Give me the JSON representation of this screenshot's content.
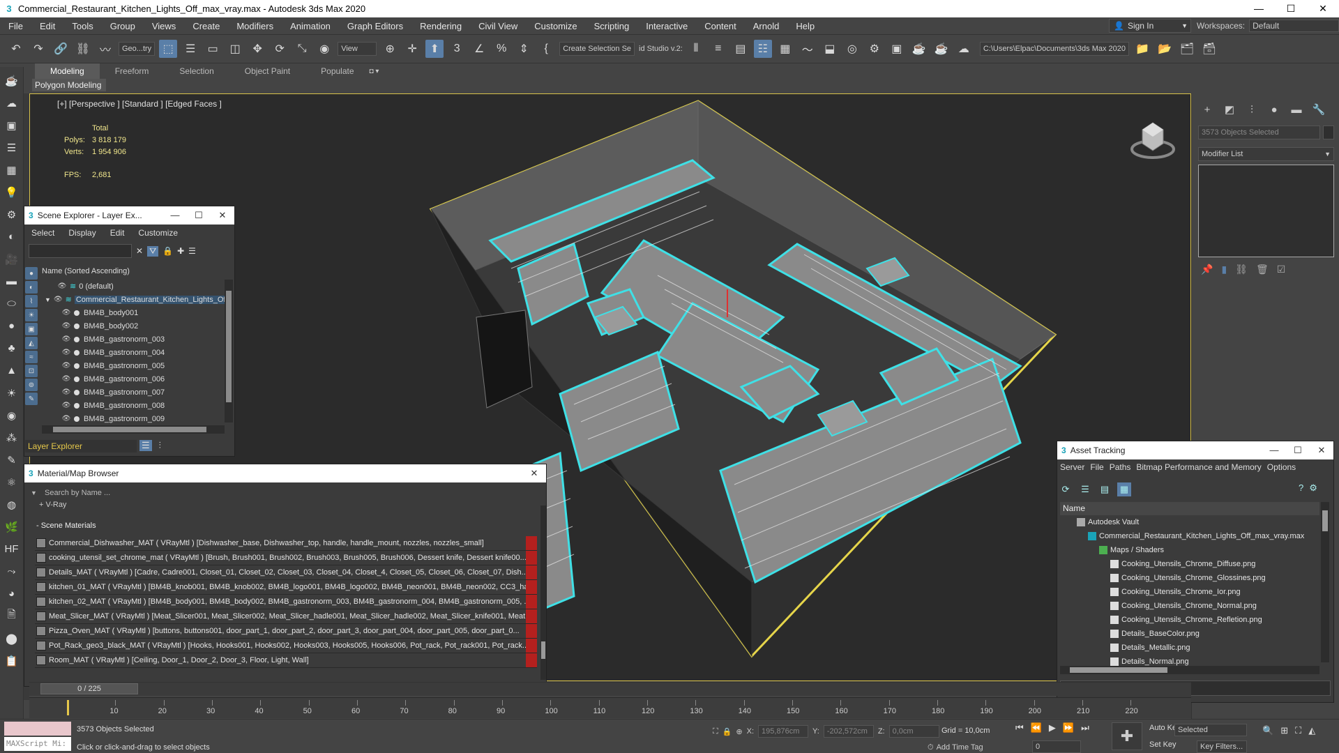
{
  "title": "Commercial_Restaurant_Kitchen_Lights_Off_max_vray.max - Autodesk 3ds Max 2020",
  "window_buttons": [
    "—",
    "☐",
    "✕"
  ],
  "menu": [
    "File",
    "Edit",
    "Tools",
    "Group",
    "Views",
    "Create",
    "Modifiers",
    "Animation",
    "Graph Editors",
    "Rendering",
    "Civil View",
    "Customize",
    "Scripting",
    "Interactive",
    "Content",
    "Arnold",
    "Help"
  ],
  "signin": "Sign In",
  "workspace": {
    "label": "Workspaces:",
    "value": "Default"
  },
  "toolbar": {
    "geometry_filter": "Geo...try",
    "view_drop": "View",
    "create_selection_set": "Create Selection Se",
    "studio_label": "id Studio v.2:",
    "path": "C:\\Users\\Elpac\\Documents\\3ds Max 2020"
  },
  "ribbon_tabs": [
    "Modeling",
    "Freeform",
    "Selection",
    "Object Paint",
    "Populate"
  ],
  "polygon_modeling": "Polygon Modeling",
  "viewport": {
    "label": "[+] [Perspective ] [Standard ] [Edged Faces ]",
    "stats_total": "Total",
    "polys_label": "Polys:",
    "polys": "3 818 179",
    "verts_label": "Verts:",
    "verts": "1 954 906",
    "fps_label": "FPS:",
    "fps": "2,681"
  },
  "command_panel": {
    "objects_selected": "3573 Objects Selected",
    "modifier_list": "Modifier List"
  },
  "scene_explorer": {
    "title": "Scene Explorer - Layer Ex...",
    "menu": [
      "Select",
      "Display",
      "Edit",
      "Customize"
    ],
    "column": "Name (Sorted Ascending)",
    "rows": [
      {
        "name": "0 (default)",
        "selected": false
      },
      {
        "name": "Commercial_Restaurant_Kitchen_Lights_Off",
        "selected": true
      },
      {
        "name": "BM4B_body001",
        "selected": false
      },
      {
        "name": "BM4B_body002",
        "selected": false
      },
      {
        "name": "BM4B_gastronorm_003",
        "selected": false
      },
      {
        "name": "BM4B_gastronorm_004",
        "selected": false
      },
      {
        "name": "BM4B_gastronorm_005",
        "selected": false
      },
      {
        "name": "BM4B_gastronorm_006",
        "selected": false
      },
      {
        "name": "BM4B_gastronorm_007",
        "selected": false
      },
      {
        "name": "BM4B_gastronorm_008",
        "selected": false
      },
      {
        "name": "BM4B_gastronorm_009",
        "selected": false
      }
    ],
    "footer": "Layer Explorer"
  },
  "material_browser": {
    "title": "Material/Map Browser",
    "search_placeholder": "Search by Name ...",
    "vray_group": "+ V-Ray",
    "scene_group": "- Scene Materials",
    "materials": [
      "Commercial_Dishwasher_MAT ( VRayMtl ) [Dishwasher_base, Dishwasher_top, handle, handle_mount, nozzles, nozzles_small]",
      "cooking_utensil_set_chrome_mat ( VRayMtl ) [Brush, Brush001, Brush002, Brush003, Brush005, Brush006, Dessert knife, Dessert knife00...",
      "Details_MAT ( VRayMtl ) [Cadre, Cadre001, Closet_01, Closet_02, Closet_03, Closet_04, Closet_4, Closet_05, Closet_06, Closet_07, Dish...",
      "kitchen_01_MAT ( VRayMtl ) [BM4B_knob001, BM4B_knob002, BM4B_logo001, BM4B_logo002, BM4B_neon001, BM4B_neon002, CC3_ha...",
      "kitchen_02_MAT ( VRayMtl ) [BM4B_body001, BM4B_body002, BM4B_gastronorm_003, BM4B_gastronorm_004, BM4B_gastronorm_005, ...",
      "Meat_Slicer_MAT ( VRayMtl ) [Meat_Slicer001, Meat_Slicer002, Meat_Slicer_hadle001, Meat_Slicer_hadle002, Meat_Slicer_knife001, Meat...",
      "Pizza_Oven_MAT ( VRayMtl ) [buttons, buttons001, door_part_1, door_part_2, door_part_3, door_part_004, door_part_005, door_part_0...",
      "Pot_Rack_geo3_black_MAT ( VRayMtl ) [Hooks, Hooks001, Hooks002, Hooks003, Hooks005, Hooks006, Pot_rack, Pot_rack001, Pot_rack...",
      "Room_MAT ( VRayMtl ) [Ceiling, Door_1, Door_2, Door_3, Floor, Light, Wall]"
    ]
  },
  "asset_tracking": {
    "title": "Asset Tracking",
    "menu": [
      "Server",
      "File",
      "Paths",
      "Bitmap Performance and Memory",
      "Options"
    ],
    "column": "Name",
    "rows": [
      {
        "name": "Autodesk Vault",
        "indent": 0
      },
      {
        "name": "Commercial_Restaurant_Kitchen_Lights_Off_max_vray.max",
        "indent": 1
      },
      {
        "name": "Maps / Shaders",
        "indent": 2
      },
      {
        "name": "Cooking_Utensils_Chrome_Diffuse.png",
        "indent": 3
      },
      {
        "name": "Cooking_Utensils_Chrome_Glossines.png",
        "indent": 3
      },
      {
        "name": "Cooking_Utensils_Chrome_Ior.png",
        "indent": 3
      },
      {
        "name": "Cooking_Utensils_Chrome_Normal.png",
        "indent": 3
      },
      {
        "name": "Cooking_Utensils_Chrome_Refletion.png",
        "indent": 3
      },
      {
        "name": "Details_BaseColor.png",
        "indent": 3
      },
      {
        "name": "Details_Metallic.png",
        "indent": 3
      },
      {
        "name": "Details_Normal.png",
        "indent": 3
      }
    ]
  },
  "timeline": {
    "slider": "0 / 225",
    "ticks": [
      "10",
      "20",
      "30",
      "40",
      "50",
      "60",
      "70",
      "80",
      "90",
      "100",
      "110",
      "120",
      "130",
      "140",
      "150",
      "160",
      "170",
      "180",
      "190",
      "200",
      "210",
      "220"
    ]
  },
  "status": {
    "maxscript": "MAXScript Mi:",
    "objects_selected": "3573 Objects Selected",
    "prompt": "Click or click-and-drag to select objects",
    "x_label": "X:",
    "x": "195,876cm",
    "y_label": "Y:",
    "y": "-202,572cm",
    "z_label": "Z:",
    "z": "0,0cm",
    "grid": "Grid = 10,0cm",
    "add_time_tag": "Add Time Tag",
    "frame": "0",
    "auto_key": "Auto Key",
    "set_key": "Set Key",
    "key_selected": "Selected",
    "key_filters": "Key Filters..."
  }
}
